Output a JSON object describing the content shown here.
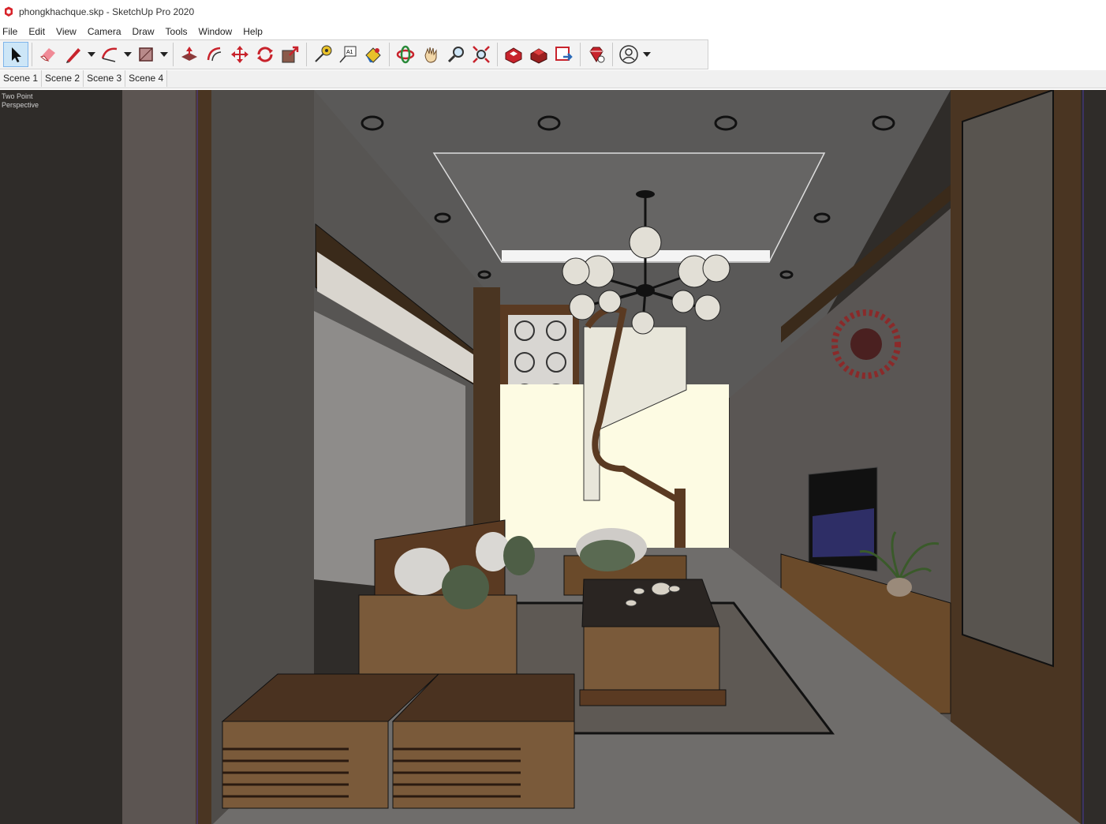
{
  "window": {
    "title": "phongkhachque.skp - SketchUp Pro 2020"
  },
  "menu": [
    "File",
    "Edit",
    "View",
    "Camera",
    "Draw",
    "Tools",
    "Window",
    "Help"
  ],
  "toolbar": {
    "tools": [
      {
        "name": "select-icon"
      },
      {
        "name": "eraser-icon"
      },
      {
        "name": "line-icon"
      },
      {
        "name": "arc-icon"
      },
      {
        "name": "rectangle-icon"
      },
      {
        "name": "push-pull-icon"
      },
      {
        "name": "offset-icon"
      },
      {
        "name": "move-icon"
      },
      {
        "name": "rotate-icon"
      },
      {
        "name": "scale-icon"
      },
      {
        "name": "tape-measure-icon"
      },
      {
        "name": "text-icon"
      },
      {
        "name": "paint-bucket-icon"
      },
      {
        "name": "orbit-icon"
      },
      {
        "name": "pan-icon"
      },
      {
        "name": "zoom-icon"
      },
      {
        "name": "zoom-extents-icon"
      },
      {
        "name": "warehouse-icon"
      },
      {
        "name": "extension-warehouse-icon"
      },
      {
        "name": "layout-icon"
      },
      {
        "name": "ruby-icon"
      },
      {
        "name": "account-icon"
      }
    ]
  },
  "scenes": [
    "Scene 1",
    "Scene 2",
    "Scene 3",
    "Scene 4"
  ],
  "viewport": {
    "camera_label_line1": "Two Point",
    "camera_label_line2": "Perspective"
  },
  "colors": {
    "accent_select": "#cde6f7",
    "sketchup_red": "#c8232c"
  }
}
